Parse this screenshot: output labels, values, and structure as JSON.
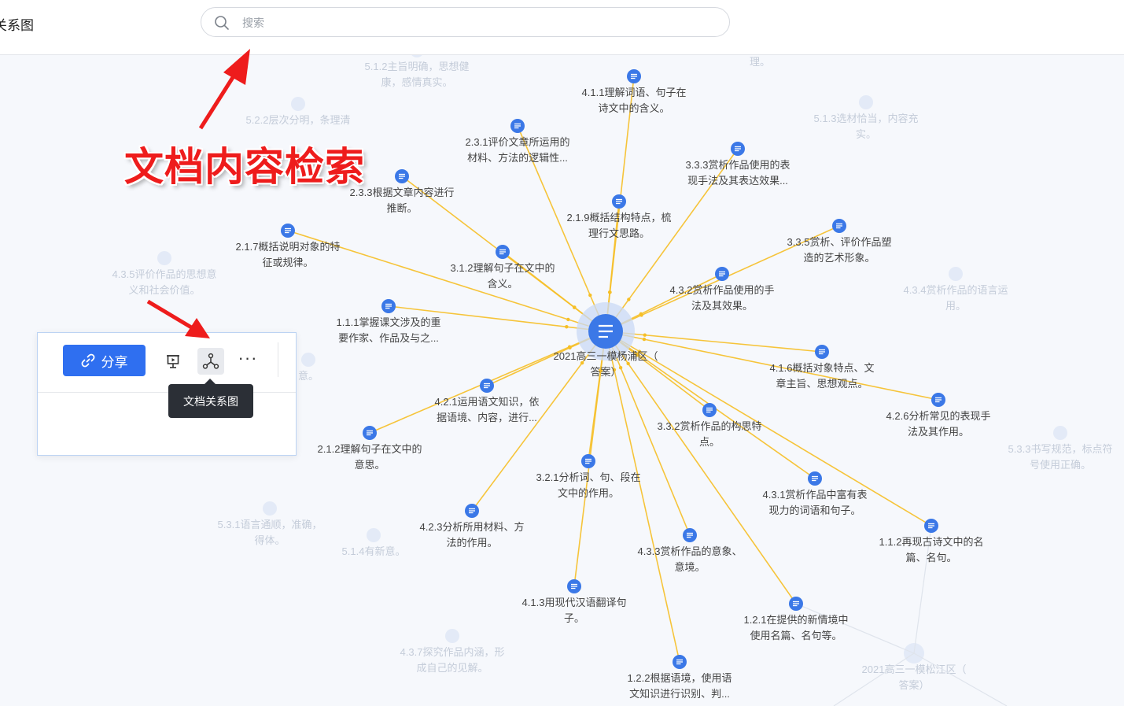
{
  "app": {
    "title": "关系图"
  },
  "search": {
    "placeholder": "搜索"
  },
  "annotation": {
    "text": "文档内容检索"
  },
  "toolbar": {
    "share_label": "分享",
    "more_label": "···",
    "tooltip": "文档关系图"
  },
  "colors": {
    "accent": "#2f6ff0",
    "edge": "#f6bf26",
    "node": "#3b78e7",
    "annotation": "#ee1c1c"
  },
  "graph": {
    "center": {
      "label1": "2021高三一模杨浦区（",
      "label2": "答案）"
    },
    "nodes": [
      {
        "id": "4.1.1",
        "line1": "4.1.1理解词语、句子在",
        "line2": "诗文中的含义。"
      },
      {
        "id": "2.3.1",
        "line1": "2.3.1评价文章所运用的",
        "line2": "材料、方法的逻辑性..."
      },
      {
        "id": "3.3.3",
        "line1": "3.3.3赏析作品使用的表",
        "line2": "现手法及其表达效果..."
      },
      {
        "id": "2.3.3",
        "line1": "2.3.3根据文章内容进行",
        "line2": "推断。"
      },
      {
        "id": "2.1.9",
        "line1": "2.1.9概括结构特点，梳",
        "line2": "理行文思路。"
      },
      {
        "id": "3.3.5",
        "line1": "3.3.5赏析、评价作品塑",
        "line2": "造的艺术形象。"
      },
      {
        "id": "2.1.7",
        "line1": "2.1.7概括说明对象的特",
        "line2": "征或规律。"
      },
      {
        "id": "3.1.2",
        "line1": "3.1.2理解句子在文中的",
        "line2": "含义。"
      },
      {
        "id": "4.3.2",
        "line1": "4.3.2赏析作品使用的手",
        "line2": "法及其效果。"
      },
      {
        "id": "1.1.1",
        "line1": "1.1.1掌握课文涉及的重",
        "line2": "要作家、作品及与之..."
      },
      {
        "id": "4.1.6",
        "line1": "4.1.6概括对象特点、文",
        "line2": "章主旨、思想观点。"
      },
      {
        "id": "4.2.6",
        "line1": "4.2.6分析常见的表现手",
        "line2": "法及其作用。"
      },
      {
        "id": "4.2.1",
        "line1": "4.2.1运用语文知识，依",
        "line2": "据语境、内容，进行..."
      },
      {
        "id": "3.3.2",
        "line1": "3.3.2赏析作品的构思特",
        "line2": "点。"
      },
      {
        "id": "2.1.2",
        "line1": "2.1.2理解句子在文中的",
        "line2": "意思。"
      },
      {
        "id": "3.2.1",
        "line1": "3.2.1分析词、句、段在",
        "line2": "文中的作用。"
      },
      {
        "id": "4.3.1",
        "line1": "4.3.1赏析作品中富有表",
        "line2": "现力的词语和句子。"
      },
      {
        "id": "4.2.3",
        "line1": "4.2.3分析所用材料、方",
        "line2": "法的作用。"
      },
      {
        "id": "1.1.2",
        "line1": "1.1.2再现古诗文中的名",
        "line2": "篇、名句。"
      },
      {
        "id": "4.3.3",
        "line1": "4.3.3赏析作品的意象、",
        "line2": "意境。"
      },
      {
        "id": "4.1.3",
        "line1": "4.1.3用现代汉语翻译句",
        "line2": "子。"
      },
      {
        "id": "1.2.1",
        "line1": "1.2.1在提供的新情境中",
        "line2": "使用名篇、名句等。"
      },
      {
        "id": "1.2.2",
        "line1": "1.2.2根据语境，使用语",
        "line2": "文知识进行识别、判..."
      }
    ],
    "faded": [
      {
        "line1": "5.1.2主旨明确，思想健",
        "line2": "康，感情真实。"
      },
      {
        "line1": "理。",
        "line2": ""
      },
      {
        "line1": "5.2.2层次分明，条理清",
        "line2": ""
      },
      {
        "line1": "5.1.3选材恰当，内容充",
        "line2": "实。"
      },
      {
        "line1": "4.3.5评价作品的思想意",
        "line2": "义和社会价值。"
      },
      {
        "line1": "4.3.4赏析作品的语言运",
        "line2": "用。"
      },
      {
        "line1": "意。",
        "line2": ""
      },
      {
        "line1": "5.3.3书写规范，标点符",
        "line2": "号使用正确。"
      },
      {
        "line1": "5.3.1语言通顺，准确，",
        "line2": "得体。"
      },
      {
        "line1": "5.1.4有新意。",
        "line2": ""
      },
      {
        "line1": "4.3.7探究作品内涵，形",
        "line2": "成自己的见解。"
      },
      {
        "line1": "2021高三一模松江区（",
        "line2": "答案）"
      }
    ]
  }
}
